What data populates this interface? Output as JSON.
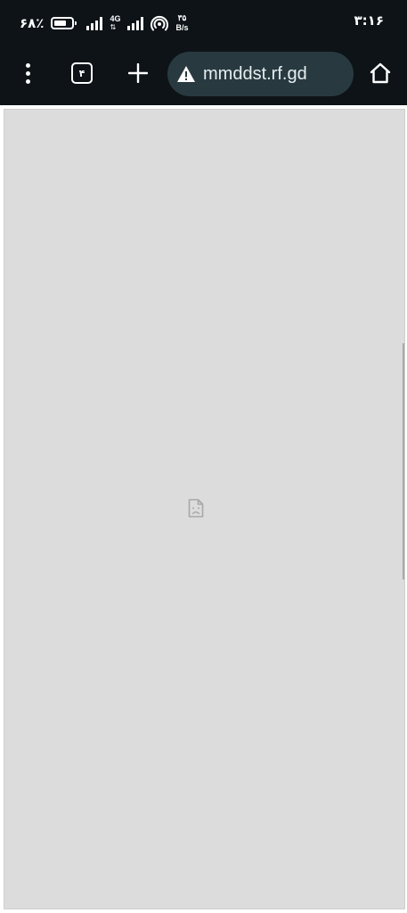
{
  "status_bar": {
    "battery_percent": "۶۸٪",
    "battery_level": 0.68,
    "network_type": "4G",
    "network_arrows": "⇅",
    "speed_value": "۳۵",
    "speed_unit": "B/s",
    "time": "۳:۱۶",
    "icons": [
      "battery-icon",
      "signal-icon",
      "hotspot-icon"
    ]
  },
  "toolbar": {
    "tab_count": "۴",
    "url": "mmddst.rf.gd",
    "icons": [
      "more-vert-icon",
      "tab-switcher-icon",
      "plus-icon",
      "warning-icon",
      "home-icon"
    ],
    "colors": {
      "bar_background": "#0d1317",
      "omnibox_background": "#283a40"
    }
  },
  "page": {
    "background": "#dcdcdc",
    "icons": [
      "broken-image-icon"
    ]
  }
}
